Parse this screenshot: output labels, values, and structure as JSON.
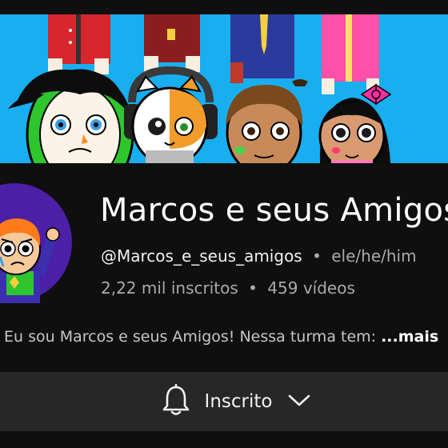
{
  "channel": {
    "name": "Marcos e seus Amigos",
    "handle": "@Marcos_e_seus_amigos",
    "separator": "•",
    "pronouns": "ele/he/him",
    "subscribers": "2,22 mil inscritos",
    "videos": "459 vídeos"
  },
  "description": {
    "text": "Eu sou Marcos e seus Amigos! Nessa turma tem: ",
    "more_label": "...mais"
  },
  "subscribe": {
    "label": "Inscrito",
    "bell_icon": "bell-icon",
    "chevron_icon": "chevron-down-icon"
  },
  "colors": {
    "background": "#0f0f0f",
    "banner_sky": "#19aef0",
    "button_bg": "#272727",
    "secondary_text": "#aaaaaa"
  }
}
